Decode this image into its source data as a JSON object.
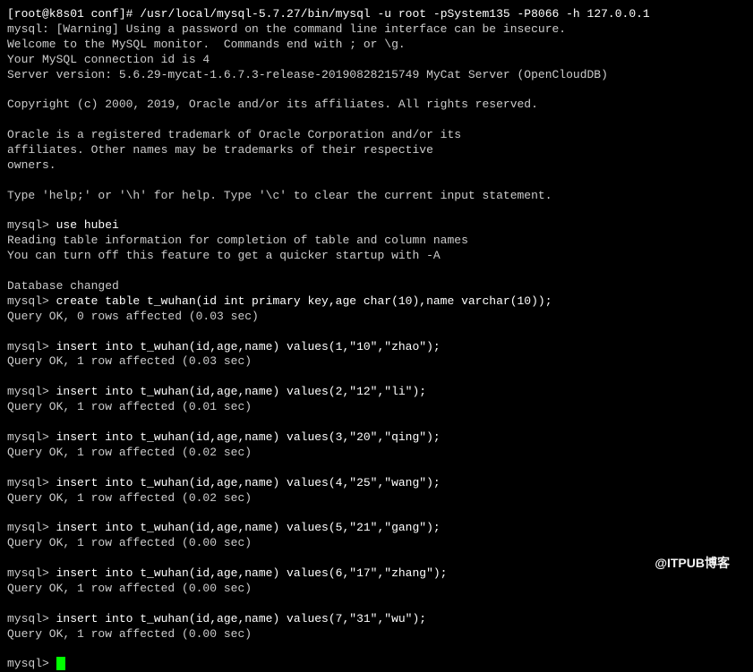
{
  "prompt": {
    "shell": "[root@k8s01 conf]# ",
    "mysql": "mysql> "
  },
  "lines": {
    "cmd1": "/usr/local/mysql-5.7.27/bin/mysql -u root -pSystem135 -P8066 -h 127.0.0.1",
    "warn": "mysql: [Warning] Using a password on the command line interface can be insecure.",
    "welcome1": "Welcome to the MySQL monitor.  Commands end with ; or \\g.",
    "welcome2": "Your MySQL connection id is 4",
    "welcome3": "Server version: 5.6.29-mycat-1.6.7.3-release-20190828215749 MyCat Server (OpenCloudDB)",
    "copyright": "Copyright (c) 2000, 2019, Oracle and/or its affiliates. All rights reserved.",
    "tm1": "Oracle is a registered trademark of Oracle Corporation and/or its",
    "tm2": "affiliates. Other names may be trademarks of their respective",
    "tm3": "owners.",
    "help": "Type 'help;' or '\\h' for help. Type '\\c' to clear the current input statement.",
    "use": "use hubei",
    "reading1": "Reading table information for completion of table and column names",
    "reading2": "You can turn off this feature to get a quicker startup with -A",
    "changed": "Database changed",
    "create": "create table t_wuhan(id int primary key,age char(10),name varchar(10));",
    "ok0": "Query OK, 0 rows affected (0.03 sec)",
    "ins1": "insert into t_wuhan(id,age,name) values(1,\"10\",\"zhao\");",
    "ok1": "Query OK, 1 row affected (0.03 sec)",
    "ins2": "insert into t_wuhan(id,age,name) values(2,\"12\",\"li\");",
    "ok2": "Query OK, 1 row affected (0.01 sec)",
    "ins3": "insert into t_wuhan(id,age,name) values(3,\"20\",\"qing\");",
    "ok3": "Query OK, 1 row affected (0.02 sec)",
    "ins4": "insert into t_wuhan(id,age,name) values(4,\"25\",\"wang\");",
    "ok4": "Query OK, 1 row affected (0.02 sec)",
    "ins5": "insert into t_wuhan(id,age,name) values(5,\"21\",\"gang\");",
    "ok5": "Query OK, 1 row affected (0.00 sec)",
    "ins6": "insert into t_wuhan(id,age,name) values(6,\"17\",\"zhang\");",
    "ok6": "Query OK, 1 row affected (0.00 sec)",
    "ins7": "insert into t_wuhan(id,age,name) values(7,\"31\",\"wu\");",
    "ok7": "Query OK, 1 row affected (0.00 sec)"
  },
  "watermark": "@ITPUB博客"
}
